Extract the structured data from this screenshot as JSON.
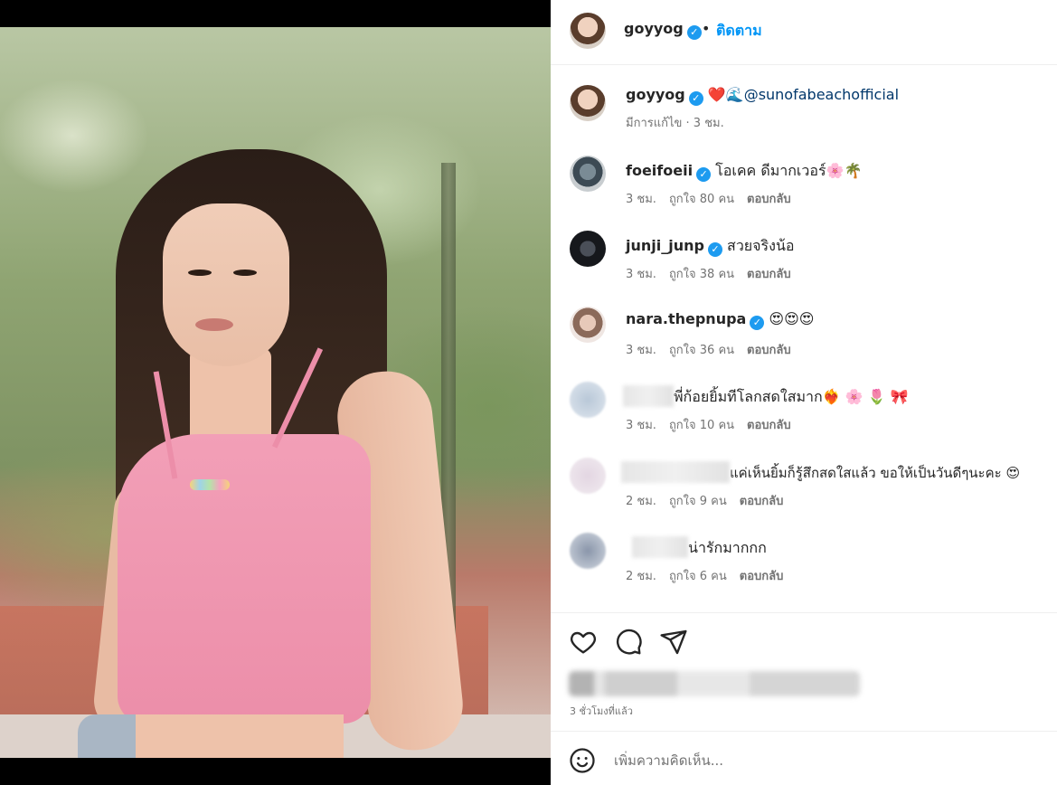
{
  "post": {
    "username": "goyyog",
    "follow_label": "ติดตาม",
    "separator": "•",
    "verified_glyph": "✓",
    "media": {
      "slide_count": 2,
      "active_slide": 2
    }
  },
  "caption": {
    "username": "goyyog",
    "emoji": "❤️🌊",
    "mention": "@sunofabeachofficial",
    "meta": "มีการแก้ไข · 3 ชม."
  },
  "comments": [
    {
      "username": "foeifoeii",
      "verified": true,
      "text": "โอเคค ดีมากเวอร์🌸🌴",
      "time": "3 ชม.",
      "likes": "ถูกใจ 80 คน",
      "reply": "ตอบกลับ"
    },
    {
      "username": "junji_junp",
      "verified": true,
      "text": "สวยจริงน้อ",
      "time": "3 ชม.",
      "likes": "ถูกใจ 38 คน",
      "reply": "ตอบกลับ"
    },
    {
      "username": "nara.thepnupa",
      "verified": true,
      "text": "😍😍😍",
      "time": "3 ชม.",
      "likes": "ถูกใจ 36 คน",
      "reply": "ตอบกลับ"
    },
    {
      "username": "",
      "verified": false,
      "text": "พี่ก้อยยิ้มทีโลกสดใสมาก❤️‍🔥 🌸 🌷 🎀",
      "time": "3 ชม.",
      "likes": "ถูกใจ 10 คน",
      "reply": "ตอบกลับ"
    },
    {
      "username": "",
      "verified": false,
      "text": "แค่เห็นยิ้มก็รู้สึกสดใสแล้ว ขอให้เป็นวันดีๆนะคะ 😍",
      "time": "2 ชม.",
      "likes": "ถูกใจ 9 คน",
      "reply": "ตอบกลับ"
    },
    {
      "username": "",
      "verified": false,
      "text": "น่ารักมากกก",
      "time": "2 ชม.",
      "likes": "ถูกใจ 6 คน",
      "reply": "ตอบกลับ"
    }
  ],
  "footer": {
    "time_ago": "3 ชั่วโมงที่แล้ว",
    "add_comment_placeholder": "เพิ่มความคิดเห็น..."
  },
  "icons": {
    "like": "heart-icon",
    "comment": "comment-icon",
    "share": "share-icon",
    "emoji": "emoji-icon",
    "verified": "verified-badge-icon"
  },
  "colors": {
    "accent": "#0095f6",
    "verified": "#1d9bf0",
    "meta_text": "#737373",
    "mention": "#00376b"
  }
}
